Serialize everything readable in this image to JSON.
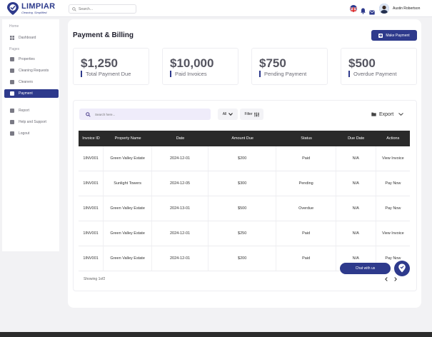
{
  "brand": {
    "name": "LIMPIAR",
    "tagline": "Cleaning. Simplified."
  },
  "header": {
    "search_placeholder": "Search...",
    "user_name": "Austin Robertson"
  },
  "sidebar": {
    "section_home": "Home",
    "section_pages": "Pages",
    "items": [
      {
        "label": "Dashboard",
        "icon": "dashboard-icon"
      },
      {
        "label": "Properties",
        "icon": "home-icon"
      },
      {
        "label": "Cleaning Requests",
        "icon": "clipboard-icon"
      },
      {
        "label": "Cleaners",
        "icon": "clipboard-icon"
      },
      {
        "label": "Payment",
        "icon": "wallet-icon",
        "active": true
      },
      {
        "label": "Report",
        "icon": "report-icon"
      },
      {
        "label": "Help and Support",
        "icon": "help-icon"
      },
      {
        "label": "Logout",
        "icon": "logout-icon"
      }
    ]
  },
  "page": {
    "title": "Payment & Billing",
    "make_payment_label": "Make Payment"
  },
  "stats": [
    {
      "value": "$1,250",
      "label": "Total Payment Due"
    },
    {
      "value": "$10,000",
      "label": "Paid Invoices"
    },
    {
      "value": "$750",
      "label": "Pending Payment"
    },
    {
      "value": "$500",
      "label": "Overdue Payment"
    }
  ],
  "table": {
    "search_placeholder": "Search here...",
    "all_label": "All",
    "filter_label": "Filter",
    "export_label": "Export",
    "columns": [
      "Invoice ID",
      "Property Name",
      "Date",
      "Amount Due",
      "Status",
      "Due Date",
      "Actions"
    ],
    "rows": [
      [
        "1INV001",
        "Green Valley Estate",
        "2024-12-01",
        "$200",
        "Paid",
        "N/A",
        "View Invoice"
      ],
      [
        "1INV001",
        "Sunlight Towers",
        "2024-12-05",
        "$300",
        "Pending",
        "N/A",
        "Pay Now"
      ],
      [
        "1INV001",
        "Green Valley Estate",
        "2024-13-01",
        "$500",
        "Overdue",
        "N/A",
        "Pay Now"
      ],
      [
        "1INV001",
        "Green Valley Estate",
        "2024-12-01",
        "$250",
        "Paid",
        "N/A",
        "View Invoice"
      ],
      [
        "1INV001",
        "Green Valley Estate",
        "2024-12-01",
        "$200",
        "Paid",
        "N/A",
        "Pay Now"
      ]
    ],
    "showing": "Showing 1of2"
  },
  "chat": {
    "label": "Chat with us"
  },
  "colors": {
    "primary": "#2e3a8c",
    "table_header": "#2a2a2a",
    "search_bg": "#efecfa"
  }
}
